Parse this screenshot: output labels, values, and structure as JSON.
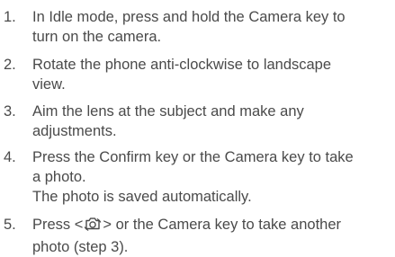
{
  "steps": [
    {
      "number": "1.",
      "lines": [
        "In Idle mode, press and hold the Camera key to",
        "turn on the camera."
      ]
    },
    {
      "number": "2.",
      "lines": [
        "Rotate the phone anti-clockwise to landscape",
        "view."
      ]
    },
    {
      "number": "3.",
      "lines": [
        "Aim the lens at the subject and make any",
        "adjustments."
      ]
    },
    {
      "number": "4.",
      "lines": [
        "Press the Confirm key or the Camera key to take",
        "a photo."
      ],
      "note": "The photo is saved automatically."
    },
    {
      "number": "5.",
      "line1_before": "Press <",
      "line1_icon": "camera-icon",
      "line1_after": "> or the Camera key to take another",
      "line2": "photo (step 3)."
    }
  ]
}
